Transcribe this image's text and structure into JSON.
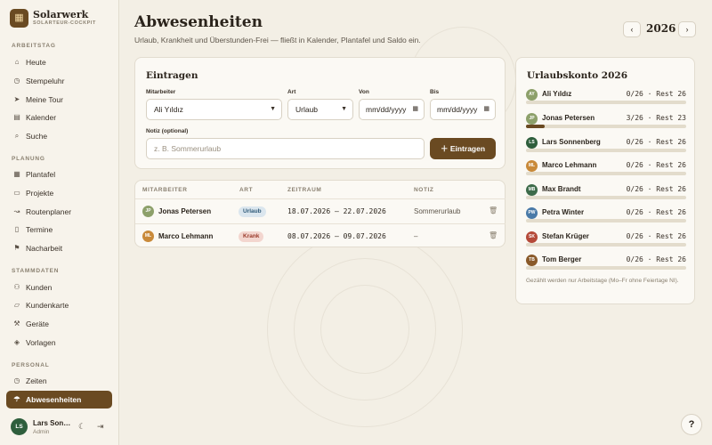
{
  "brand": {
    "name": "Solarwerk",
    "subtitle": "SOLARTEUR-COCKPIT",
    "logo_icon": "solar-panel-icon"
  },
  "nav": {
    "sections": [
      {
        "label": "ARBEITSTAG",
        "items": [
          {
            "label": "Heute",
            "icon": "home-icon"
          },
          {
            "label": "Stempeluhr",
            "icon": "clock-icon"
          },
          {
            "label": "Meine Tour",
            "icon": "navigation-icon"
          },
          {
            "label": "Kalender",
            "icon": "calendar-icon"
          },
          {
            "label": "Suche",
            "icon": "search-icon"
          }
        ]
      },
      {
        "label": "PLANUNG",
        "items": [
          {
            "label": "Plantafel",
            "icon": "grid-icon"
          },
          {
            "label": "Projekte",
            "icon": "folder-icon"
          },
          {
            "label": "Routenplaner",
            "icon": "route-icon"
          },
          {
            "label": "Termine",
            "icon": "document-icon"
          },
          {
            "label": "Nacharbeit",
            "icon": "flag-icon"
          }
        ]
      },
      {
        "label": "STAMMDATEN",
        "items": [
          {
            "label": "Kunden",
            "icon": "users-icon"
          },
          {
            "label": "Kundenkarte",
            "icon": "map-icon"
          },
          {
            "label": "Geräte",
            "icon": "tool-icon"
          },
          {
            "label": "Vorlagen",
            "icon": "layers-icon"
          }
        ]
      },
      {
        "label": "PERSONAL",
        "items": [
          {
            "label": "Zeiten",
            "icon": "clock-icon"
          },
          {
            "label": "Abwesenheiten",
            "icon": "umbrella-icon",
            "active": true
          }
        ]
      }
    ]
  },
  "user": {
    "initials": "LS",
    "name": "Lars Son…",
    "role": "Admin"
  },
  "header": {
    "title": "Abwesenheiten",
    "subtitle": "Urlaub, Krankheit und Überstunden-Frei — fließt in Kalender, Plantafel und Saldo ein.",
    "year": "2026",
    "prev": "‹",
    "next": "›"
  },
  "form": {
    "title": "Eintragen",
    "employee_label": "Mitarbeiter",
    "employee_value": "Ali Yıldız",
    "type_label": "Art",
    "type_value": "Urlaub",
    "from_label": "Von",
    "from_placeholder": "mm/dd/yyyy",
    "to_label": "Bis",
    "to_placeholder": "mm/dd/yyyy",
    "note_label": "Notiz (optional)",
    "note_placeholder": "z. B. Sommerurlaub",
    "submit_label": "Eintragen"
  },
  "table": {
    "headers": {
      "employee": "MITARBEITER",
      "type": "ART",
      "period": "ZEITRAUM",
      "note": "NOTIZ"
    },
    "rows": [
      {
        "initials": "JP",
        "name": "Jonas Petersen",
        "type": "Urlaub",
        "period": "18.07.2026 – 22.07.2026",
        "note": "Sommerurlaub",
        "avatar_color": "#8da06a"
      },
      {
        "initials": "ML",
        "name": "Marco Lehmann",
        "type": "Krank",
        "period": "08.07.2026 – 09.07.2026",
        "note": "–",
        "avatar_color": "#c98a3a"
      }
    ]
  },
  "account": {
    "title": "Urlaubskonto 2026",
    "rows": [
      {
        "initials": "AY",
        "name": "Ali Yıldız",
        "value": "0/26 · Rest 26",
        "used": 0,
        "total": 26,
        "color": "#8da06a"
      },
      {
        "initials": "JP",
        "name": "Jonas Petersen",
        "value": "3/26 · Rest 23",
        "used": 3,
        "total": 26,
        "color": "#8da06a"
      },
      {
        "initials": "LS",
        "name": "Lars Sonnenberg",
        "value": "0/26 · Rest 26",
        "used": 0,
        "total": 26,
        "color": "#2e5e3c"
      },
      {
        "initials": "ML",
        "name": "Marco Lehmann",
        "value": "0/26 · Rest 26",
        "used": 0,
        "total": 26,
        "color": "#c98a3a"
      },
      {
        "initials": "MB",
        "name": "Max Brandt",
        "value": "0/26 · Rest 26",
        "used": 0,
        "total": 26,
        "color": "#3d6b4a"
      },
      {
        "initials": "PW",
        "name": "Petra Winter",
        "value": "0/26 · Rest 26",
        "used": 0,
        "total": 26,
        "color": "#4a7aa8"
      },
      {
        "initials": "SK",
        "name": "Stefan Krüger",
        "value": "0/26 · Rest 26",
        "used": 0,
        "total": 26,
        "color": "#b54a3a"
      },
      {
        "initials": "TB",
        "name": "Tom Berger",
        "value": "0/26 · Rest 26",
        "used": 0,
        "total": 26,
        "color": "#8a5a2a"
      }
    ],
    "footnote": "Gezählt werden nur Arbeitstage (Mo–Fr ohne Feiertage NI)."
  },
  "help_label": "?",
  "colors": {
    "accent": "#6a4a22",
    "background": "#f3efe5",
    "badge_urlaub": "#dbe6ee",
    "badge_krank": "#f3d6cf"
  }
}
